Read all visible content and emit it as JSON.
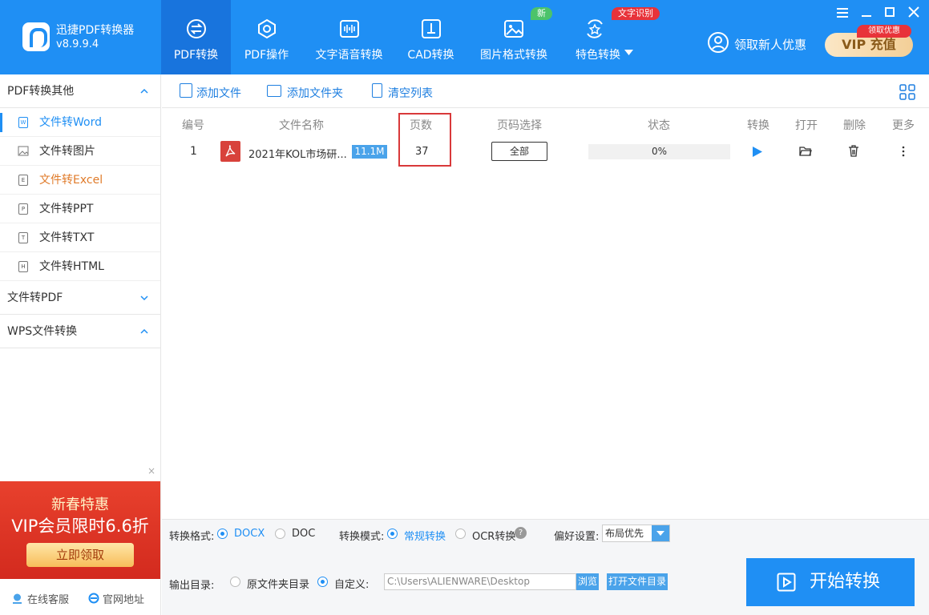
{
  "app": {
    "name": "迅捷PDF转换器",
    "version": "v8.9.9.4"
  },
  "nav": [
    {
      "label": "PDF转换",
      "icon": "pdf-convert-icon"
    },
    {
      "label": "PDF操作",
      "icon": "pdf-operate-icon"
    },
    {
      "label": "文字语音转换",
      "icon": "audio-wave-icon"
    },
    {
      "label": "CAD转换",
      "icon": "cad-icon"
    },
    {
      "label": "图片格式转换",
      "icon": "image-icon",
      "badge": "新"
    },
    {
      "label": "特色转换",
      "icon": "star-convert-icon",
      "badge": "文字识别"
    }
  ],
  "header": {
    "user_promo": "领取新人优惠",
    "vip_label": "VIP 充值",
    "vip_badge": "领取优惠"
  },
  "sidebar": {
    "sections": [
      {
        "title": "PDF转换其他",
        "items": [
          "文件转Word",
          "文件转图片",
          "文件转Excel",
          "文件转PPT",
          "文件转TXT",
          "文件转HTML"
        ]
      },
      {
        "title": "文件转PDF"
      },
      {
        "title": "WPS文件转换"
      }
    ],
    "icon_letters": [
      "W",
      "",
      "E",
      "P",
      "T",
      "H"
    ],
    "promo": {
      "line1": "新春特惠",
      "line2": "VIP会员限时6.6折",
      "button": "立即领取",
      "close": "×"
    },
    "footer": {
      "service": "在线客服",
      "website": "官网地址"
    }
  },
  "toolbar": {
    "add_file": "添加文件",
    "add_folder": "添加文件夹",
    "clear_list": "清空列表"
  },
  "table": {
    "headers": {
      "no": "编号",
      "name": "文件名称",
      "pages": "页数",
      "range": "页码选择",
      "status": "状态",
      "convert": "转换",
      "open": "打开",
      "delete": "删除",
      "more": "更多"
    },
    "rows": [
      {
        "no": "1",
        "name": "2021年KOL市场研...",
        "size": "11.1M",
        "pages": "37",
        "range": "全部",
        "status": "0%",
        "progress": 0
      }
    ]
  },
  "bottom": {
    "format_label": "转换格式:",
    "format_docx": "DOCX",
    "format_doc": "DOC",
    "mode_label": "转换模式:",
    "mode_normal": "常规转换",
    "mode_ocr": "OCR转换",
    "help": "?",
    "pref_label": "偏好设置:",
    "pref_value": "布局优先",
    "output_label": "输出目录:",
    "output_original": "原文件夹目录",
    "output_custom": "自定义:",
    "output_path": "C:\\Users\\ALIENWARE\\Desktop",
    "browse": "浏览",
    "open_folder": "打开文件目录",
    "start": "开始转换"
  },
  "colors": {
    "primary": "#1f8ff4",
    "active_nav": "#1874dd",
    "accent_orange": "#e07b2a",
    "highlight_red": "#d9393a"
  }
}
